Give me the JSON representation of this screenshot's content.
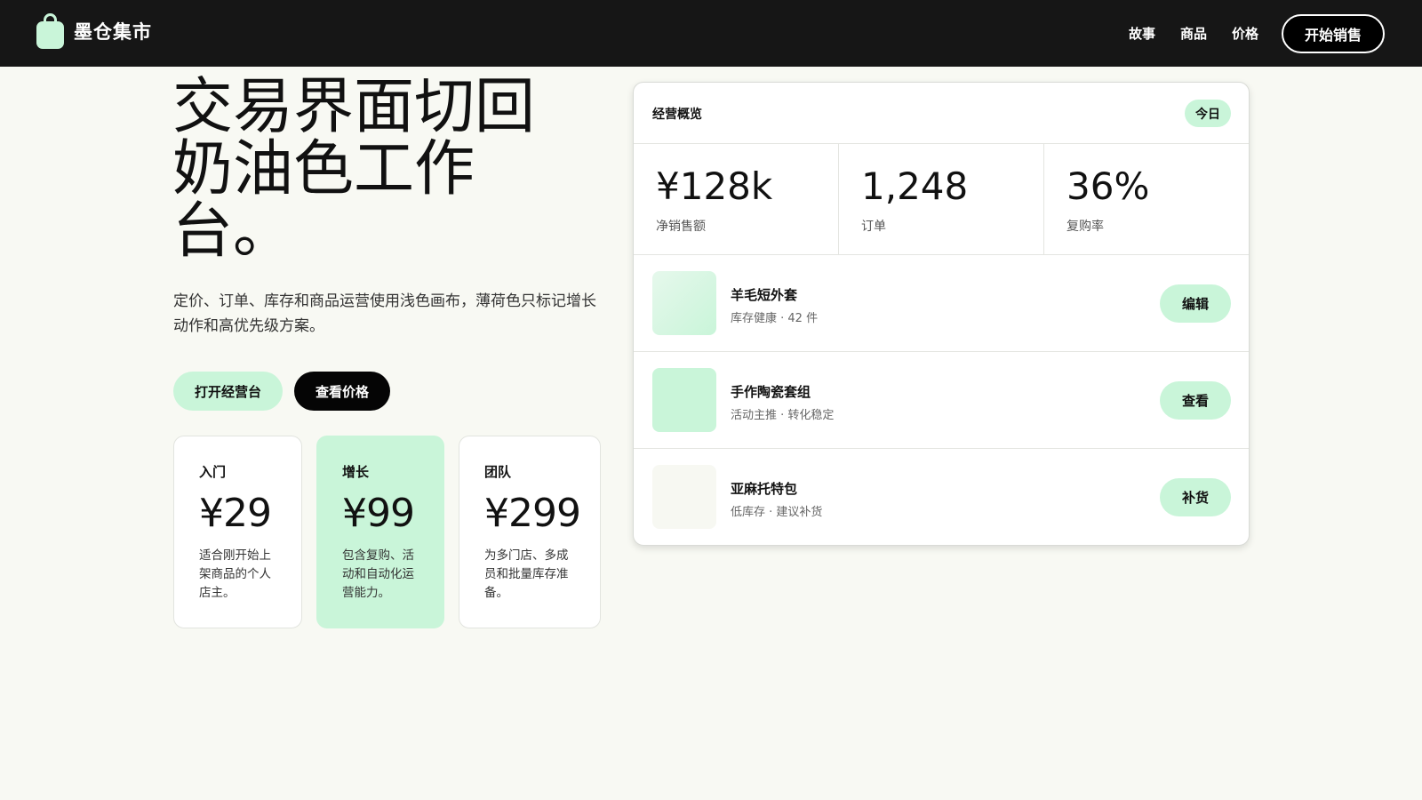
{
  "brand": {
    "name": "墨仓集市"
  },
  "nav": {
    "links": [
      "故事",
      "商品",
      "价格"
    ],
    "cta": "开始销售"
  },
  "hero": {
    "title": "交易界面切回奶油色工作台。",
    "subtitle": "定价、订单、库存和商品运营使用浅色画布，薄荷色只标记增长动作和高优先级方案。",
    "primary_button": "打开经营台",
    "secondary_button": "查看价格"
  },
  "plans": [
    {
      "name": "入门",
      "price": "¥29",
      "desc": "适合刚开始上架商品的个人店主。"
    },
    {
      "name": "增长",
      "price": "¥99",
      "desc": "包含复购、活动和自动化运营能力。"
    },
    {
      "name": "团队",
      "price": "¥299",
      "desc": "为多门店、多成员和批量库存准备。"
    }
  ],
  "dashboard": {
    "title": "经营概览",
    "badge": "今日",
    "stats": [
      {
        "value": "¥128k",
        "label": "净销售额"
      },
      {
        "value": "1,248",
        "label": "订单"
      },
      {
        "value": "36%",
        "label": "复购率"
      }
    ],
    "products": [
      {
        "name": "羊毛短外套",
        "meta": "库存健康 · 42 件",
        "action": "编辑"
      },
      {
        "name": "手作陶瓷套组",
        "meta": "活动主推 · 转化稳定",
        "action": "查看"
      },
      {
        "name": "亚麻托特包",
        "meta": "低库存 · 建议补货",
        "action": "补货"
      }
    ]
  },
  "colors": {
    "mint": "#c9f5d9",
    "nav_bg": "#161616",
    "canvas": "#f8f9f3"
  }
}
